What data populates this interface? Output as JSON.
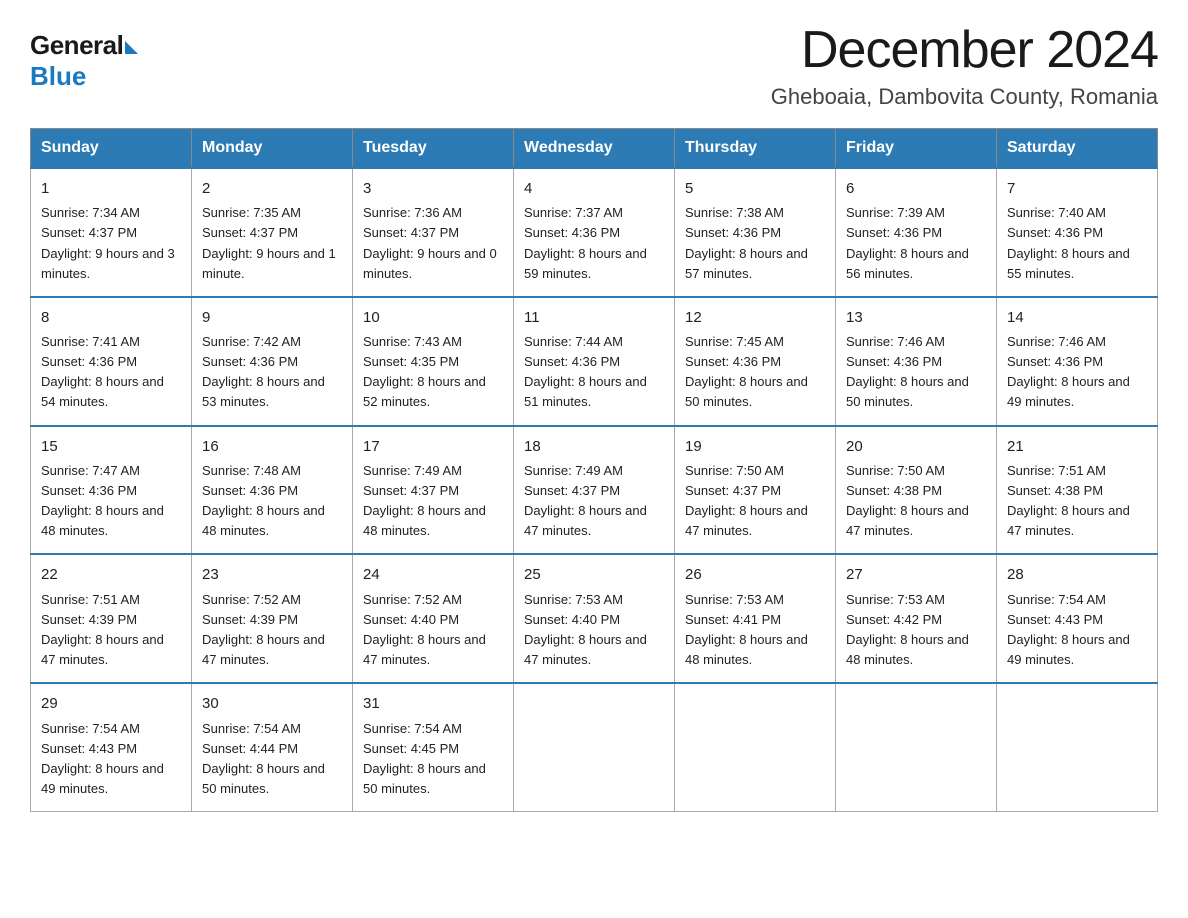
{
  "header": {
    "logo_general": "General",
    "logo_blue": "Blue",
    "month_title": "December 2024",
    "location": "Gheboaia, Dambovita County, Romania"
  },
  "days_of_week": [
    "Sunday",
    "Monday",
    "Tuesday",
    "Wednesday",
    "Thursday",
    "Friday",
    "Saturday"
  ],
  "weeks": [
    [
      {
        "day": "1",
        "sunrise": "7:34 AM",
        "sunset": "4:37 PM",
        "daylight": "9 hours and 3 minutes."
      },
      {
        "day": "2",
        "sunrise": "7:35 AM",
        "sunset": "4:37 PM",
        "daylight": "9 hours and 1 minute."
      },
      {
        "day": "3",
        "sunrise": "7:36 AM",
        "sunset": "4:37 PM",
        "daylight": "9 hours and 0 minutes."
      },
      {
        "day": "4",
        "sunrise": "7:37 AM",
        "sunset": "4:36 PM",
        "daylight": "8 hours and 59 minutes."
      },
      {
        "day": "5",
        "sunrise": "7:38 AM",
        "sunset": "4:36 PM",
        "daylight": "8 hours and 57 minutes."
      },
      {
        "day": "6",
        "sunrise": "7:39 AM",
        "sunset": "4:36 PM",
        "daylight": "8 hours and 56 minutes."
      },
      {
        "day": "7",
        "sunrise": "7:40 AM",
        "sunset": "4:36 PM",
        "daylight": "8 hours and 55 minutes."
      }
    ],
    [
      {
        "day": "8",
        "sunrise": "7:41 AM",
        "sunset": "4:36 PM",
        "daylight": "8 hours and 54 minutes."
      },
      {
        "day": "9",
        "sunrise": "7:42 AM",
        "sunset": "4:36 PM",
        "daylight": "8 hours and 53 minutes."
      },
      {
        "day": "10",
        "sunrise": "7:43 AM",
        "sunset": "4:35 PM",
        "daylight": "8 hours and 52 minutes."
      },
      {
        "day": "11",
        "sunrise": "7:44 AM",
        "sunset": "4:36 PM",
        "daylight": "8 hours and 51 minutes."
      },
      {
        "day": "12",
        "sunrise": "7:45 AM",
        "sunset": "4:36 PM",
        "daylight": "8 hours and 50 minutes."
      },
      {
        "day": "13",
        "sunrise": "7:46 AM",
        "sunset": "4:36 PM",
        "daylight": "8 hours and 50 minutes."
      },
      {
        "day": "14",
        "sunrise": "7:46 AM",
        "sunset": "4:36 PM",
        "daylight": "8 hours and 49 minutes."
      }
    ],
    [
      {
        "day": "15",
        "sunrise": "7:47 AM",
        "sunset": "4:36 PM",
        "daylight": "8 hours and 48 minutes."
      },
      {
        "day": "16",
        "sunrise": "7:48 AM",
        "sunset": "4:36 PM",
        "daylight": "8 hours and 48 minutes."
      },
      {
        "day": "17",
        "sunrise": "7:49 AM",
        "sunset": "4:37 PM",
        "daylight": "8 hours and 48 minutes."
      },
      {
        "day": "18",
        "sunrise": "7:49 AM",
        "sunset": "4:37 PM",
        "daylight": "8 hours and 47 minutes."
      },
      {
        "day": "19",
        "sunrise": "7:50 AM",
        "sunset": "4:37 PM",
        "daylight": "8 hours and 47 minutes."
      },
      {
        "day": "20",
        "sunrise": "7:50 AM",
        "sunset": "4:38 PM",
        "daylight": "8 hours and 47 minutes."
      },
      {
        "day": "21",
        "sunrise": "7:51 AM",
        "sunset": "4:38 PM",
        "daylight": "8 hours and 47 minutes."
      }
    ],
    [
      {
        "day": "22",
        "sunrise": "7:51 AM",
        "sunset": "4:39 PM",
        "daylight": "8 hours and 47 minutes."
      },
      {
        "day": "23",
        "sunrise": "7:52 AM",
        "sunset": "4:39 PM",
        "daylight": "8 hours and 47 minutes."
      },
      {
        "day": "24",
        "sunrise": "7:52 AM",
        "sunset": "4:40 PM",
        "daylight": "8 hours and 47 minutes."
      },
      {
        "day": "25",
        "sunrise": "7:53 AM",
        "sunset": "4:40 PM",
        "daylight": "8 hours and 47 minutes."
      },
      {
        "day": "26",
        "sunrise": "7:53 AM",
        "sunset": "4:41 PM",
        "daylight": "8 hours and 48 minutes."
      },
      {
        "day": "27",
        "sunrise": "7:53 AM",
        "sunset": "4:42 PM",
        "daylight": "8 hours and 48 minutes."
      },
      {
        "day": "28",
        "sunrise": "7:54 AM",
        "sunset": "4:43 PM",
        "daylight": "8 hours and 49 minutes."
      }
    ],
    [
      {
        "day": "29",
        "sunrise": "7:54 AM",
        "sunset": "4:43 PM",
        "daylight": "8 hours and 49 minutes."
      },
      {
        "day": "30",
        "sunrise": "7:54 AM",
        "sunset": "4:44 PM",
        "daylight": "8 hours and 50 minutes."
      },
      {
        "day": "31",
        "sunrise": "7:54 AM",
        "sunset": "4:45 PM",
        "daylight": "8 hours and 50 minutes."
      },
      null,
      null,
      null,
      null
    ]
  ]
}
